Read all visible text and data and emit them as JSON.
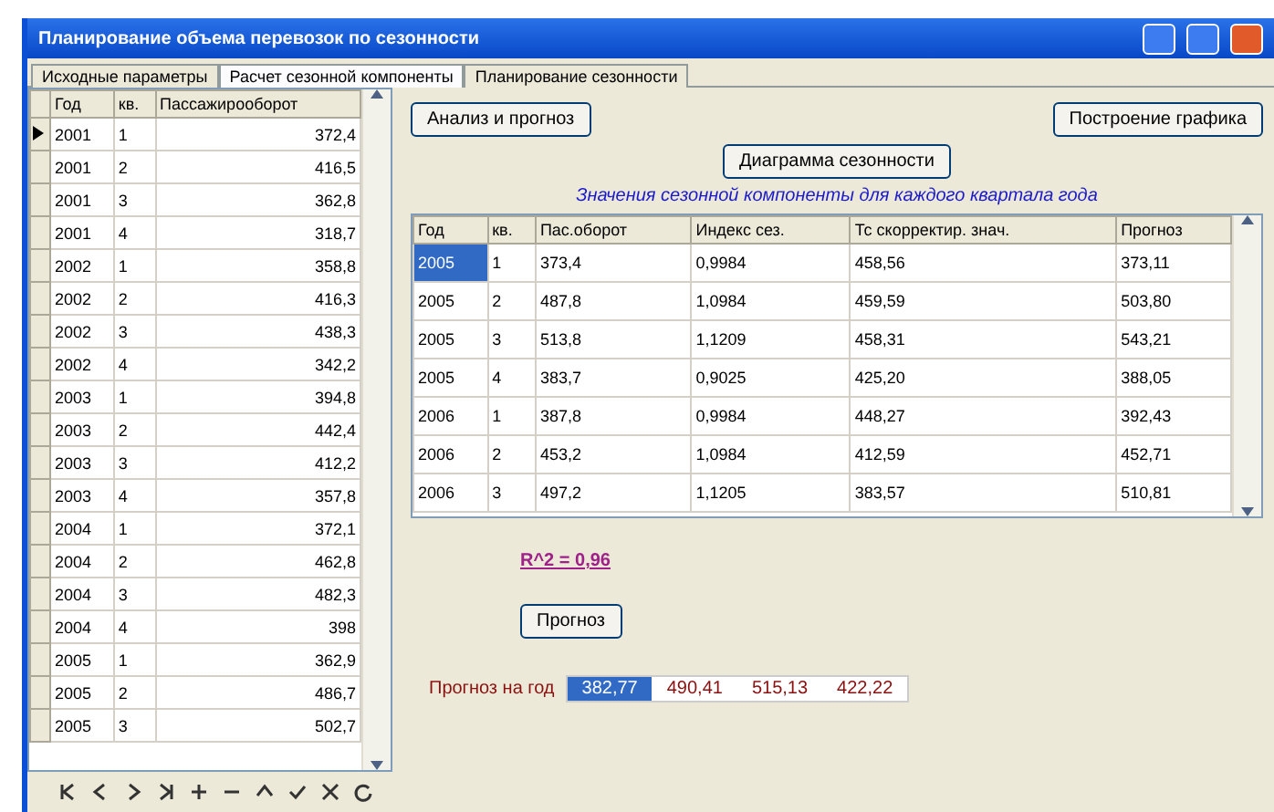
{
  "window": {
    "title": "Планирование объема перевозок по сезонности"
  },
  "tabs": [
    {
      "label": "Исходные параметры",
      "selected": false
    },
    {
      "label": "Расчет сезонной компоненты",
      "selected": true
    },
    {
      "label": "Планирование сезонности",
      "selected": false
    }
  ],
  "source_table": {
    "columns": [
      "Год",
      "кв.",
      "Пассажирооборот"
    ],
    "rows": [
      {
        "cells": [
          "2001",
          "1",
          "372,4"
        ],
        "selected": true
      },
      {
        "cells": [
          "2001",
          "2",
          "416,5"
        ],
        "selected": false
      },
      {
        "cells": [
          "2001",
          "3",
          "362,8"
        ],
        "selected": false
      },
      {
        "cells": [
          "2001",
          "4",
          "318,7"
        ],
        "selected": false
      },
      {
        "cells": [
          "2002",
          "1",
          "358,8"
        ],
        "selected": false
      },
      {
        "cells": [
          "2002",
          "2",
          "416,3"
        ],
        "selected": false
      },
      {
        "cells": [
          "2002",
          "3",
          "438,3"
        ],
        "selected": false
      },
      {
        "cells": [
          "2002",
          "4",
          "342,2"
        ],
        "selected": false
      },
      {
        "cells": [
          "2003",
          "1",
          "394,8"
        ],
        "selected": false
      },
      {
        "cells": [
          "2003",
          "2",
          "442,4"
        ],
        "selected": false
      },
      {
        "cells": [
          "2003",
          "3",
          "412,2"
        ],
        "selected": false
      },
      {
        "cells": [
          "2003",
          "4",
          "357,8"
        ],
        "selected": false
      },
      {
        "cells": [
          "2004",
          "1",
          "372,1"
        ],
        "selected": false
      },
      {
        "cells": [
          "2004",
          "2",
          "462,8"
        ],
        "selected": false
      },
      {
        "cells": [
          "2004",
          "3",
          "482,3"
        ],
        "selected": false
      },
      {
        "cells": [
          "2004",
          "4",
          "398"
        ],
        "selected": false
      },
      {
        "cells": [
          "2005",
          "1",
          "362,9"
        ],
        "selected": false
      },
      {
        "cells": [
          "2005",
          "2",
          "486,7"
        ],
        "selected": false
      },
      {
        "cells": [
          "2005",
          "3",
          "502,7"
        ],
        "selected": false
      }
    ]
  },
  "buttons": [
    {
      "label": "Анализ и прогноз"
    },
    {
      "label": "Построение графика"
    },
    {
      "label": "Диаграмма сезонности"
    }
  ],
  "caption": "Значения сезонной компоненты для каждого квартала года",
  "result_table": {
    "columns": [
      "Год",
      "кв.",
      "Пас.оборот",
      "Индекс сез.",
      "Тс скорректир. знач.",
      "Прогноз"
    ],
    "rows": [
      {
        "cells": [
          "2005",
          "1",
          "373,4",
          "0,9984",
          "458,56",
          "373,11"
        ],
        "selected": true
      },
      {
        "cells": [
          "2005",
          "2",
          "487,8",
          "1,0984",
          "459,59",
          "503,80"
        ],
        "selected": false
      },
      {
        "cells": [
          "2005",
          "3",
          "513,8",
          "1,1209",
          "458,31",
          "543,21"
        ],
        "selected": false
      },
      {
        "cells": [
          "2005",
          "4",
          "383,7",
          "0,9025",
          "425,20",
          "388,05"
        ],
        "selected": false
      },
      {
        "cells": [
          "2006",
          "1",
          "387,8",
          "0,9984",
          "448,27",
          "392,43"
        ],
        "selected": false
      },
      {
        "cells": [
          "2006",
          "2",
          "453,2",
          "1,0984",
          "412,59",
          "452,71"
        ],
        "selected": false
      },
      {
        "cells": [
          "2006",
          "3",
          "497,2",
          "1,1205",
          "383,57",
          "510,81"
        ],
        "selected": false
      }
    ]
  },
  "r_squared": "R^2 = 0,96",
  "forecast_button": "Прогноз",
  "forecast": {
    "label": "Прогноз на год",
    "values": [
      {
        "text": "382,77",
        "selected": true
      },
      {
        "text": "490,41",
        "selected": false
      },
      {
        "text": "515,13",
        "selected": false
      },
      {
        "text": "422,22",
        "selected": false
      }
    ]
  }
}
